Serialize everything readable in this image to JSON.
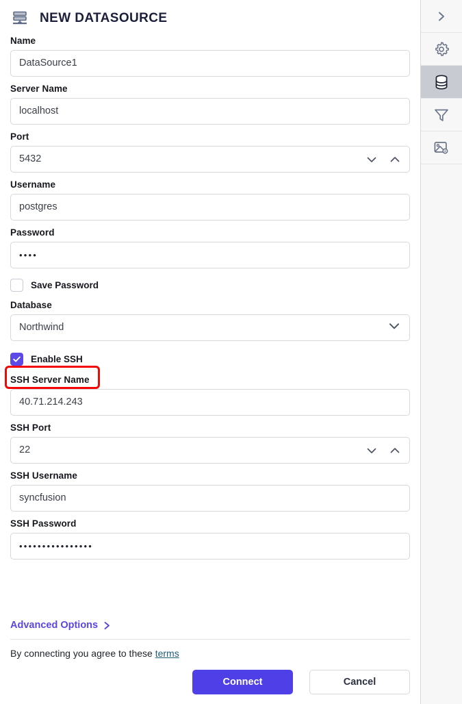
{
  "header": {
    "icon": "database-stack-icon",
    "title": "NEW DATASOURCE"
  },
  "form": {
    "name": {
      "label": "Name",
      "value": "DataSource1"
    },
    "server_name": {
      "label": "Server Name",
      "value": "localhost"
    },
    "port": {
      "label": "Port",
      "value": "5432"
    },
    "username": {
      "label": "Username",
      "value": "postgres"
    },
    "password": {
      "label": "Password",
      "value": "••••"
    },
    "save_password": {
      "label": "Save Password",
      "checked": false
    },
    "database": {
      "label": "Database",
      "value": "Northwind"
    },
    "enable_ssh": {
      "label": "Enable SSH",
      "checked": true,
      "highlighted": true
    },
    "ssh_server_name": {
      "label": "SSH Server Name",
      "value": "40.71.214.243"
    },
    "ssh_port": {
      "label": "SSH Port",
      "value": "22"
    },
    "ssh_username": {
      "label": "SSH Username",
      "value": "syncfusion"
    },
    "ssh_password": {
      "label": "SSH Password",
      "value": "••••••••••••••••"
    }
  },
  "footer": {
    "advanced_options_label": "Advanced Options",
    "terms_prefix": "By connecting you agree to these ",
    "terms_link_label": "terms",
    "connect_label": "Connect",
    "cancel_label": "Cancel"
  },
  "rail": {
    "items": [
      {
        "name": "expand-chevron-right-icon",
        "active": false
      },
      {
        "name": "gear-icon",
        "active": false
      },
      {
        "name": "database-icon",
        "active": true
      },
      {
        "name": "filter-funnel-icon",
        "active": false
      },
      {
        "name": "image-settings-icon",
        "active": false
      }
    ]
  },
  "colors": {
    "accent_purple": "#4f3fe6",
    "checkbox_checked": "#5b4ae8",
    "annotation_red": "#f60505",
    "terms_link": "#1f5e74",
    "rail_active_bg": "#c9cbd2"
  }
}
